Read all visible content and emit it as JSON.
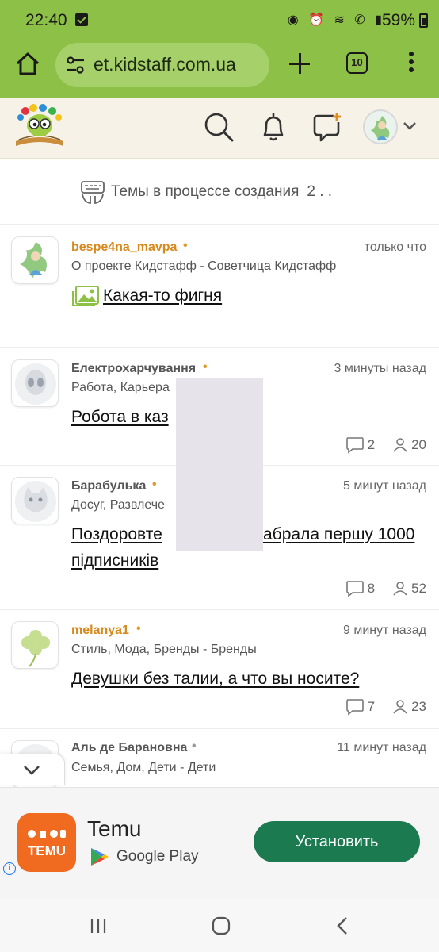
{
  "status_bar": {
    "time": "22:40",
    "battery": "59%"
  },
  "browser": {
    "url": "et.kidstaff.com.ua",
    "tab_count": "10"
  },
  "drafts": {
    "label": "Темы в процессе создания",
    "count": "2 . ."
  },
  "topics": [
    {
      "author": "bespe4na_mavpa",
      "time": "только что",
      "category": "О проекте Кидстафф - Советчица Кидстафф",
      "title": "Какая-то фигня",
      "has_image_icon": true
    },
    {
      "author": "Електрохарчування",
      "time": "3 минуты назад",
      "category": "Работа, Карьера",
      "title": "Робота в каз",
      "comments": "2",
      "views": "20"
    },
    {
      "author": "Барабулька",
      "time": "5 минут назад",
      "category": "Досуг, Развлече",
      "title_line1": "Поздоровте",
      "title_line1_tail": "абрала першу 1000",
      "title_line2": "підписників",
      "comments": "8",
      "views": "52"
    },
    {
      "author": "melanya1",
      "time": "9 минут назад",
      "category": "Стиль, Мода, Бренды - Бренды",
      "title": "Девушки без талии, а что вы носите?",
      "comments": "7",
      "views": "23"
    },
    {
      "author": "Аль де Барановна",
      "time": "11 минут назад",
      "category": "Семья, Дом, Дети - Дети"
    }
  ],
  "ad": {
    "app_name": "Temu",
    "store": "Google Play",
    "install_label": "Установить",
    "logo_text": "TEMU",
    "logo_color": "#f06a1f",
    "button_color": "#1b7a4f"
  },
  "colors": {
    "chrome": "#8dc046",
    "author_orange": "#d7891c"
  }
}
